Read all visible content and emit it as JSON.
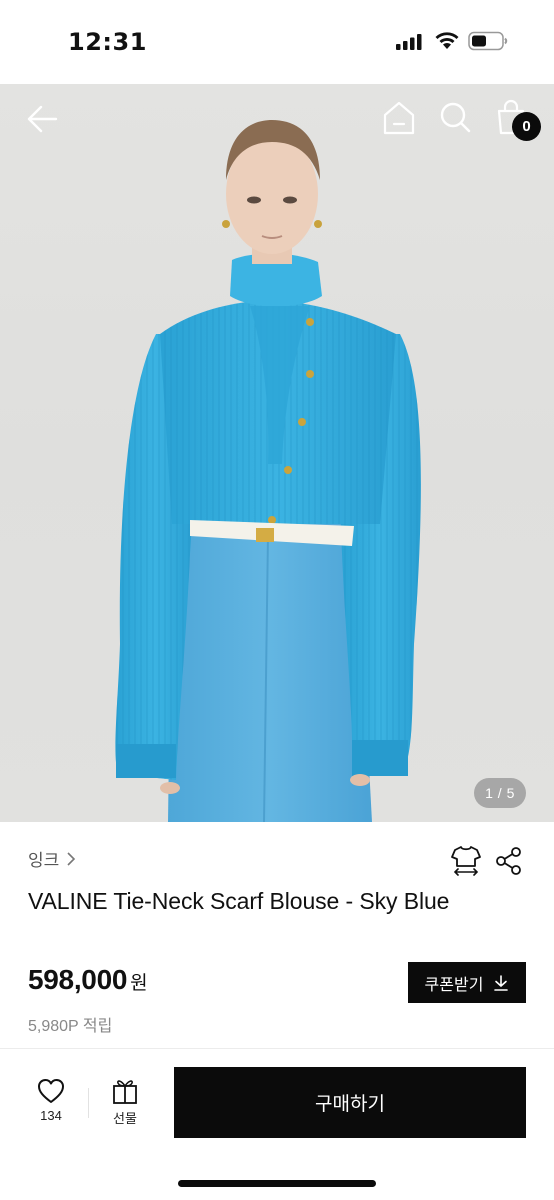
{
  "status_bar": {
    "time": "12:31"
  },
  "header": {
    "cart_count": "0"
  },
  "gallery": {
    "counter": "1 / 5"
  },
  "product": {
    "brand": "잉크",
    "title": "VALINE Tie-Neck Scarf Blouse - Sky Blue",
    "price": "598,000",
    "currency": "원",
    "points": "5,980P 적립",
    "coupon_label": "쿠폰받기"
  },
  "bottom_bar": {
    "like_count": "134",
    "gift_label": "선물",
    "buy_label": "구매하기"
  }
}
